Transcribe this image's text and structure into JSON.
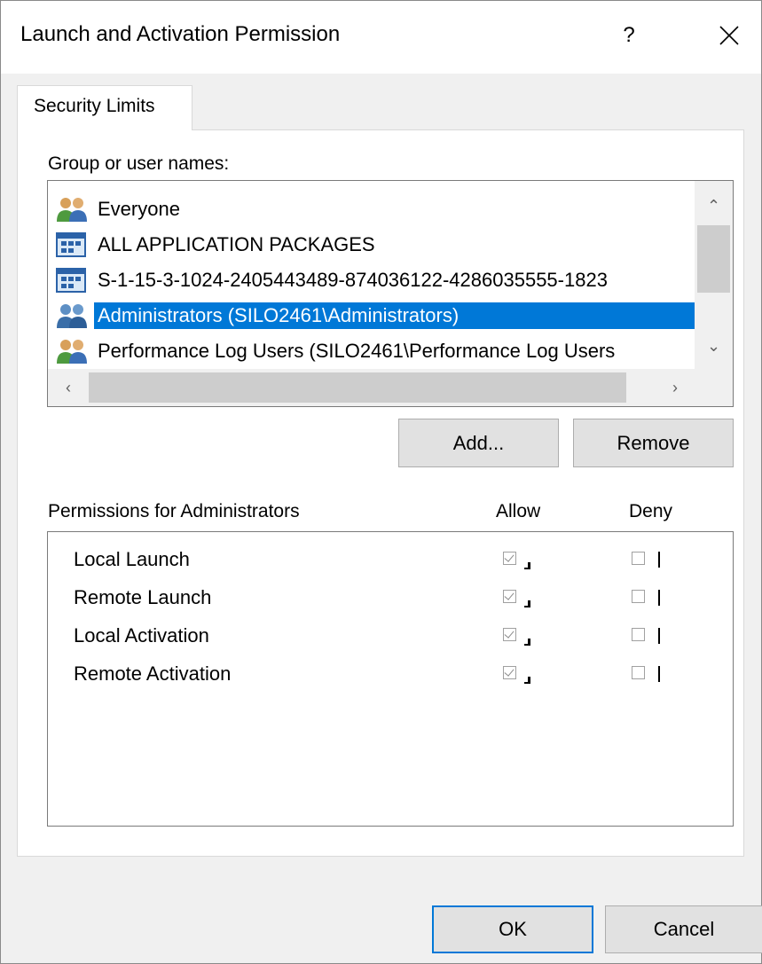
{
  "window": {
    "title": "Launch and Activation Permission",
    "help_label": "?",
    "close_icon": "close-icon"
  },
  "tabs": [
    {
      "label": "Security Limits",
      "active": true
    }
  ],
  "group_section": {
    "label": "Group or user names:",
    "items": [
      {
        "name": "Everyone",
        "icon": "group-users-icon",
        "selected": false
      },
      {
        "name": "ALL APPLICATION PACKAGES",
        "icon": "app-packages-icon",
        "selected": false
      },
      {
        "name": "S-1-15-3-1024-2405443489-874036122-4286035555-1823",
        "icon": "app-packages-icon",
        "selected": false
      },
      {
        "name": "Administrators (SILO2461\\Administrators)",
        "icon": "group-users-icon",
        "selected": true
      },
      {
        "name": "Performance Log Users (SILO2461\\Performance Log Users",
        "icon": "group-users-icon",
        "selected": false
      }
    ],
    "add_label": "Add...",
    "remove_label": "Remove"
  },
  "permissions": {
    "header": "Permissions for Administrators",
    "allow_label": "Allow",
    "deny_label": "Deny",
    "rows": [
      {
        "name": "Local Launch",
        "allow": true,
        "deny": false
      },
      {
        "name": "Remote Launch",
        "allow": true,
        "deny": false
      },
      {
        "name": "Local Activation",
        "allow": true,
        "deny": false
      },
      {
        "name": "Remote Activation",
        "allow": true,
        "deny": false
      }
    ]
  },
  "footer": {
    "ok_label": "OK",
    "cancel_label": "Cancel"
  },
  "colors": {
    "selection": "#0078d7",
    "dialog_bg": "#f0f0f0",
    "button_bg": "#e1e1e1"
  }
}
